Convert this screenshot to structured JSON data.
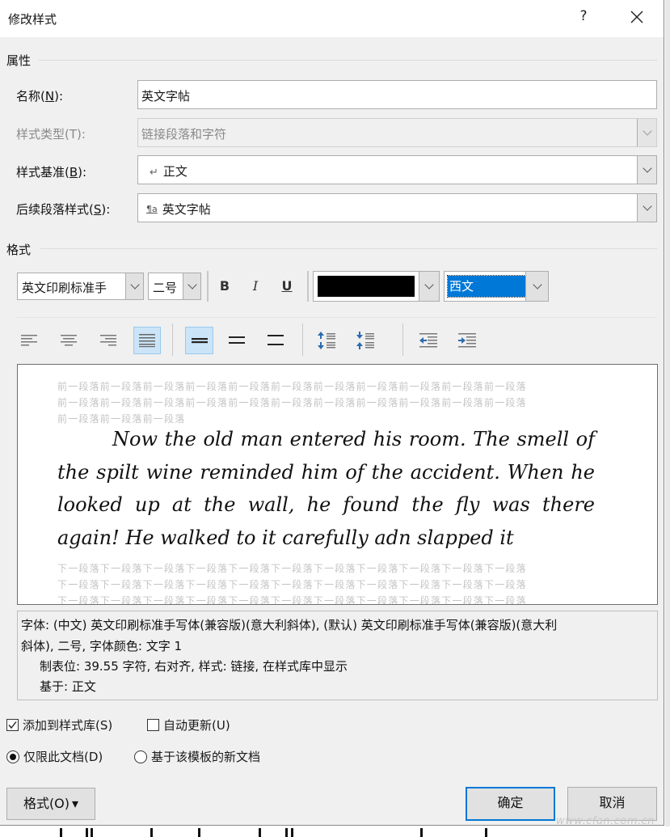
{
  "window": {
    "title": "修改样式",
    "help_label": "?",
    "close_icon": "close-icon"
  },
  "properties": {
    "section_label": "属性",
    "name_label_prefix": "名称(",
    "name_label_key": "N",
    "name_label_suffix": "):",
    "name_value": "英文字帖",
    "type_label": "样式类型(T):",
    "type_value": "链接段落和字符",
    "based_on_label_prefix": "样式基准(",
    "based_on_label_key": "B",
    "based_on_label_suffix": "):",
    "based_on_icon": "paragraph-return-icon",
    "based_on_glyph": "↵",
    "based_on_value": "正文",
    "next_label_prefix": "后续段落样式(",
    "next_label_key": "S",
    "next_label_suffix": "):",
    "next_icon": "linked-style-icon",
    "next_glyph": "¶a",
    "next_value": "英文字帖"
  },
  "format": {
    "section_label": "格式",
    "font_value": "英文印刷标准手",
    "size_value": "二号",
    "bold_label": "B",
    "italic_label": "I",
    "underline_label": "U",
    "font_color": "#000000",
    "script_value": "西文",
    "script_highlight": "#0078d7",
    "alignment_buttons": [
      {
        "name": "align-left",
        "active": false
      },
      {
        "name": "align-center",
        "active": false
      },
      {
        "name": "align-right",
        "active": false
      },
      {
        "name": "align-justify",
        "active": true
      }
    ],
    "spacing_buttons": [
      {
        "name": "single-spacing",
        "active": true
      },
      {
        "name": "one-half-spacing",
        "active": false
      },
      {
        "name": "double-spacing",
        "active": false
      }
    ],
    "paragraph_spacing_buttons": [
      {
        "name": "increase-paragraph-spacing"
      },
      {
        "name": "decrease-paragraph-spacing"
      }
    ],
    "indent_buttons": [
      {
        "name": "decrease-indent"
      },
      {
        "name": "increase-indent"
      }
    ]
  },
  "preview": {
    "previous_lines": [
      "前一段落前一段落前一段落前一段落前一段落前一段落前一段落前一段落前一段落前一段落前一段落",
      "前一段落前一段落前一段落前一段落前一段落前一段落前一段落前一段落前一段落前一段落前一段落",
      "前一段落前一段落前一段落"
    ],
    "sample_text": "Now the old man entered his room.  The smell of the spilt wine reminded him of the accident.  When he looked up at the wall,  he found the fly was there again!  He walked to it carefully adn slapped it",
    "next_lines": [
      "下一段落下一段落下一段落下一段落下一段落下一段落下一段落下一段落下一段落下一段落下一段落",
      "下一段落下一段落下一段落下一段落下一段落下一段落下一段落下一段落下一段落下一段落下一段落",
      "下一段落下一段落下一段落下一段落下一段落下一段落下一段落下一段落下一段落下一段落下一段落"
    ]
  },
  "description": {
    "lines": [
      "字体: (中文) 英文印刷标准手写体(兼容版)(意大利斜体), (默认) 英文印刷标准手写体(兼容版)(意大利",
      "斜体), 二号, 字体颜色: 文字 1",
      "制表位:  39.55 字符, 右对齐, 样式: 链接, 在样式库中显示",
      "基于: 正文"
    ]
  },
  "options": {
    "add_to_gallery_label": "添加到样式库(S)",
    "add_to_gallery_checked": true,
    "auto_update_label": "自动更新(U)",
    "auto_update_checked": false,
    "only_this_doc_label": "仅限此文档(D)",
    "only_this_doc_selected": true,
    "new_docs_label": "基于该模板的新文档",
    "new_docs_selected": false
  },
  "buttons": {
    "format_label": "格式(O)",
    "format_arrow": "▾",
    "ok_label": "确定",
    "cancel_label": "取消"
  },
  "watermark": "www.cfan.com.cn"
}
